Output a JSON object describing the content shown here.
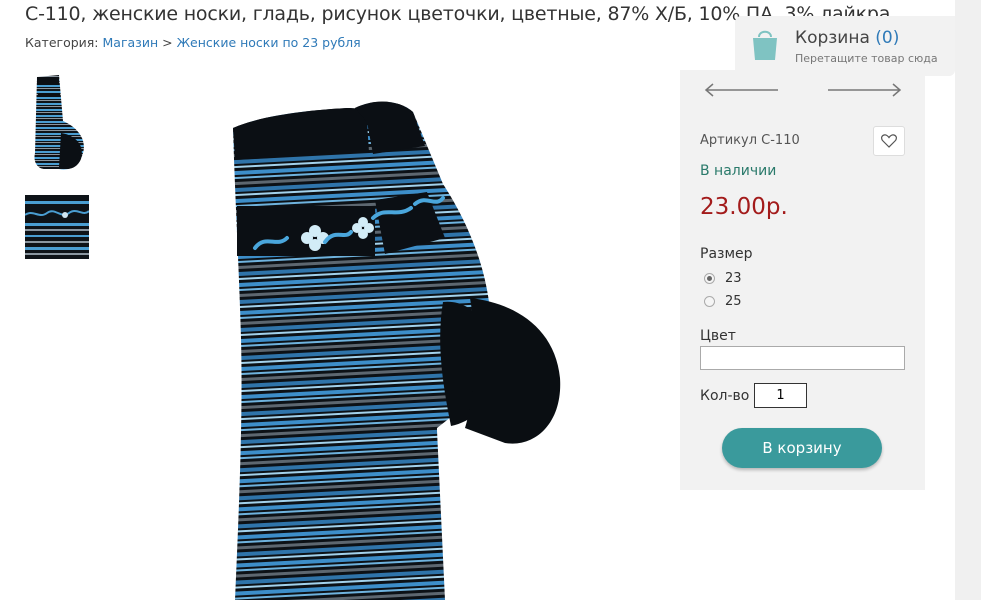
{
  "product": {
    "title": "С-110, женские носки, гладь, рисунок цветочки, цветные, 87% Х/Б, 10% ПА, 3% лайкра",
    "sku": "Артикул С-110",
    "availability": "В наличии",
    "price": "23.00р.",
    "size_label": "Размер",
    "sizes": [
      "23",
      "25"
    ],
    "selected_size": "23",
    "color_label": "Цвет",
    "color_value": "",
    "qty_label": "Кол-во",
    "qty_value": "1",
    "add_to_cart": "В корзину"
  },
  "breadcrumb": {
    "prefix": "Категория:",
    "items": [
      "Магазин",
      "Женские носки по 23 рубля"
    ],
    "separator": ">"
  },
  "cart": {
    "title": "Корзина",
    "count": "(0)",
    "hint": "Перетащите товар сюда"
  },
  "colors": {
    "accent": "#3a9a9c",
    "price": "#a31b1b",
    "stock": "#2a7a6b",
    "link": "#2f7ab8",
    "panel_bg": "#f2f2f2"
  },
  "icons": {
    "cart": "shopping-bag-icon",
    "favorite": "heart-icon",
    "prev": "arrow-left-icon",
    "next": "arrow-right-icon"
  }
}
